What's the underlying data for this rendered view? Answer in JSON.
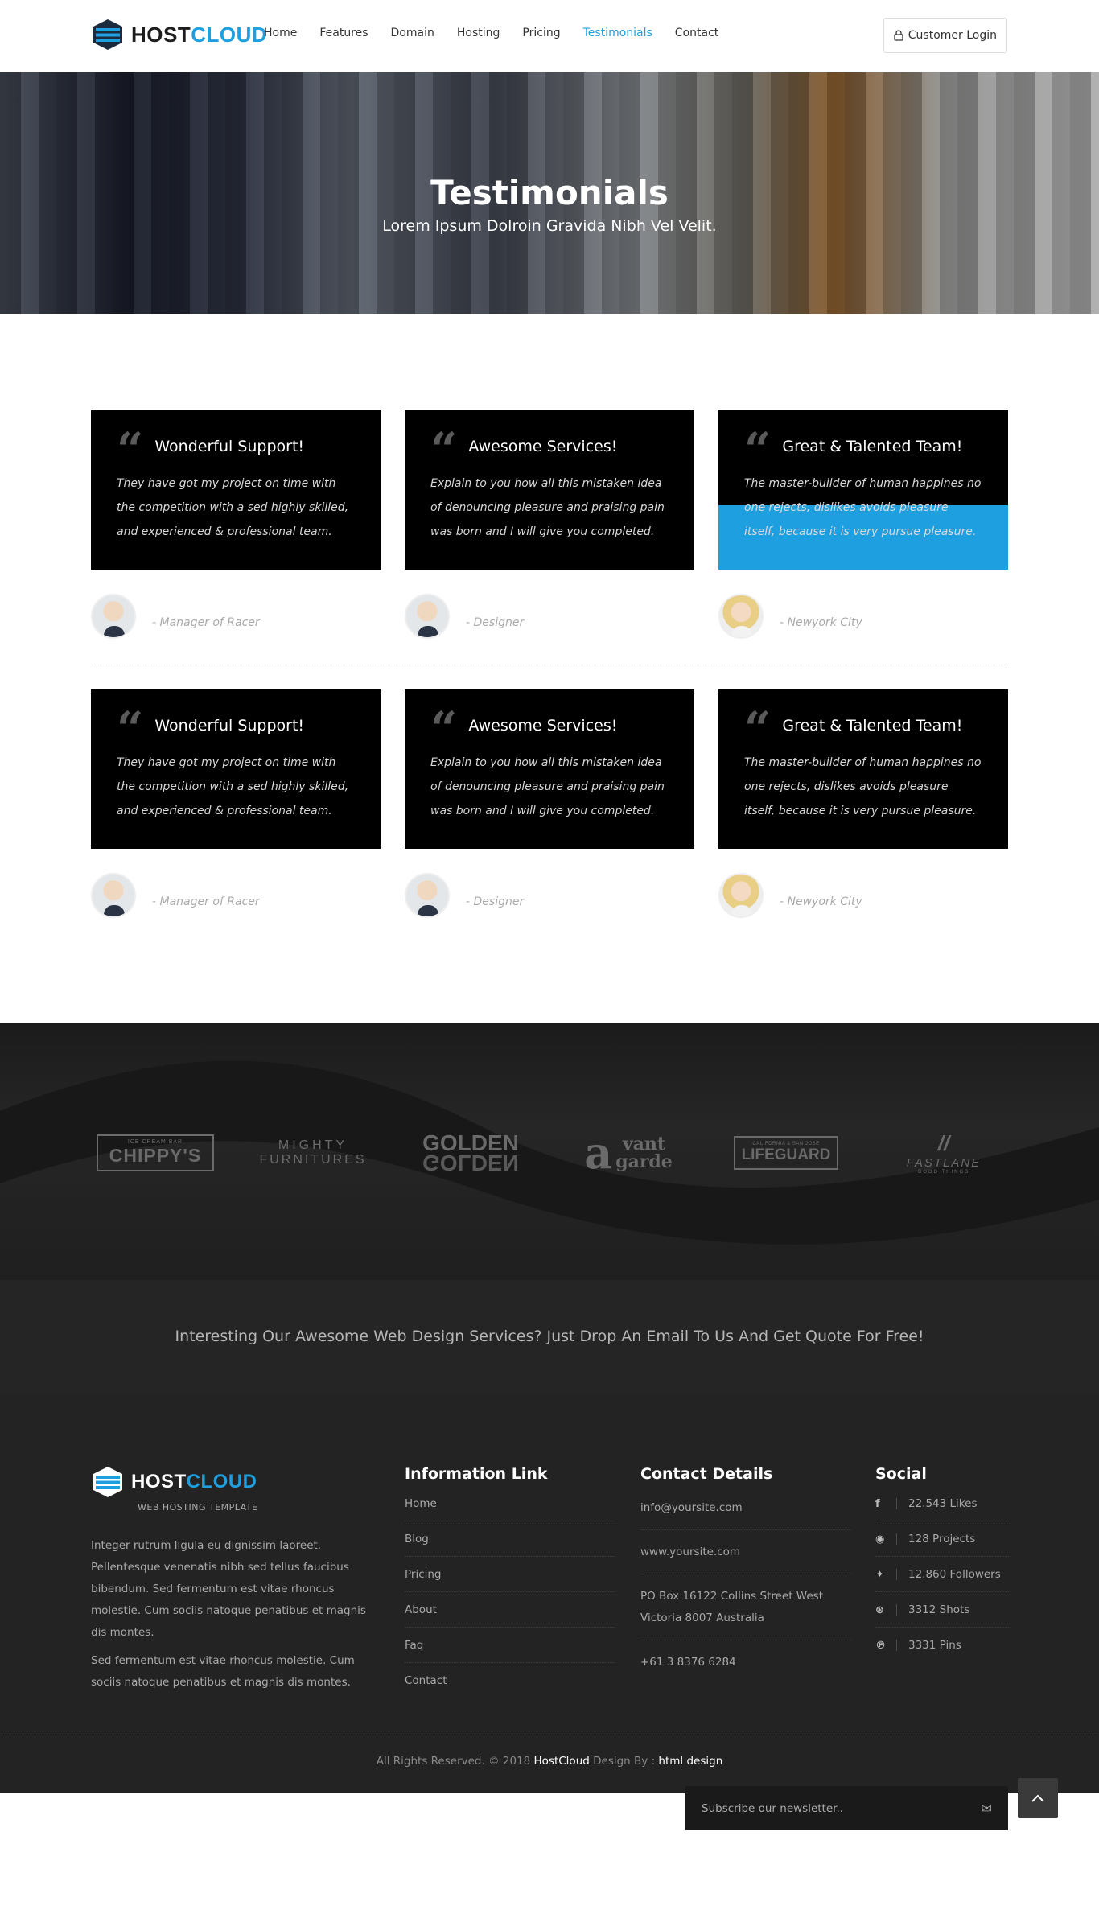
{
  "header": {
    "logo": {
      "host": "HOST",
      "cloud": "CLOUD"
    },
    "nav": [
      "Home",
      "Features",
      "Domain",
      "Hosting",
      "Pricing",
      "Testimonials",
      "Contact"
    ],
    "active_nav": "Testimonials",
    "login_label": "Customer Login"
  },
  "hero": {
    "title": "Testimonials",
    "subtitle": "Lorem Ipsum Dolroin Gravida Nibh Vel Velit."
  },
  "testimonials": [
    [
      {
        "title": "Wonderful Support!",
        "text": "They have got my project on time with the competition with a sed highly skilled, and experienced & professional team.",
        "role": "- Manager of Racer"
      },
      {
        "title": "Awesome Services!",
        "text": "Explain to you how all this mistaken idea of denouncing pleasure and praising pain was born and I will give you completed.",
        "role": "- Designer"
      },
      {
        "title": "Great & Talented Team!",
        "text": "The master-builder of human happines no one rejects, dislikes avoids pleasure itself, because it is very pursue pleasure.",
        "role": "- Newyork City"
      }
    ],
    [
      {
        "title": "Wonderful Support!",
        "text": "They have got my project on time with the competition with a sed highly skilled, and experienced & professional team.",
        "role": "- Manager of Racer"
      },
      {
        "title": "Awesome Services!",
        "text": "Explain to you how all this mistaken idea of denouncing pleasure and praising pain was born and I will give you completed.",
        "role": "- Designer"
      },
      {
        "title": "Great & Talented Team!",
        "text": "The master-builder of human happines no one rejects, dislikes avoids pleasure itself, because it is very pursue pleasure.",
        "role": "- Newyork City"
      }
    ]
  ],
  "clients": [
    {
      "top": "ICE CREAM BAR",
      "main": "CHIPPY'S"
    },
    {
      "top": "",
      "main": "MIGHTY",
      "bottom": "FURNITURES"
    },
    {
      "main": "GOLDEN",
      "bottom": "GOLDEN"
    },
    {
      "main": "vant",
      "bottom": "garde"
    },
    {
      "top": "CALIFORNIA & SAN JOSE",
      "main": "LIFEGUARD"
    },
    {
      "main": "FASTLANE",
      "bottom": "GOOD THINGS"
    }
  ],
  "cta": {
    "text": "Interesting Our Awesome Web Design Services? Just Drop An Email To Us And Get Quote For Free!"
  },
  "footer": {
    "logo": {
      "host": "HOST",
      "cloud": "CLOUD"
    },
    "tagline": "WEB HOSTING TEMPLATE",
    "desc1": "Integer rutrum ligula eu dignissim laoreet. Pellentesque venenatis nibh sed tellus faucibus bibendum. Sed fermentum est vitae rhoncus molestie. Cum sociis natoque penatibus et magnis dis montes.",
    "desc2": "Sed fermentum est vitae rhoncus molestie. Cum sociis natoque penatibus et magnis dis montes.",
    "info_heading": "Information Link",
    "info_links": [
      "Home",
      "Blog",
      "Pricing",
      "About",
      "Faq",
      "Contact"
    ],
    "contact_heading": "Contact Details",
    "contact_items": [
      "info@yoursite.com",
      "www.yoursite.com",
      "PO Box 16122 Collins Street West Victoria 8007 Australia",
      "+61 3 8376 6284"
    ],
    "social_heading": "Social",
    "social_items": [
      {
        "icon": "facebook-icon",
        "glyph": "f",
        "text": "22.543 Likes"
      },
      {
        "icon": "github-icon",
        "glyph": "◉",
        "text": "128 Projects"
      },
      {
        "icon": "twitter-icon",
        "glyph": "✦",
        "text": "12.860 Followers"
      },
      {
        "icon": "dribbble-icon",
        "glyph": "⊛",
        "text": "3312 Shots"
      },
      {
        "icon": "pinterest-icon",
        "glyph": "℗",
        "text": "3331 Pins"
      }
    ],
    "copyright_prefix": "All Rights Reserved. © 2018",
    "copyright_brand": "HostCloud",
    "copyright_mid": "Design By :",
    "copyright_designer": "html design",
    "newsletter_placeholder": "Subscribe our newsletter.."
  },
  "colors": {
    "accent": "#1ea0e0",
    "dark": "#232323",
    "card": "#000000"
  }
}
